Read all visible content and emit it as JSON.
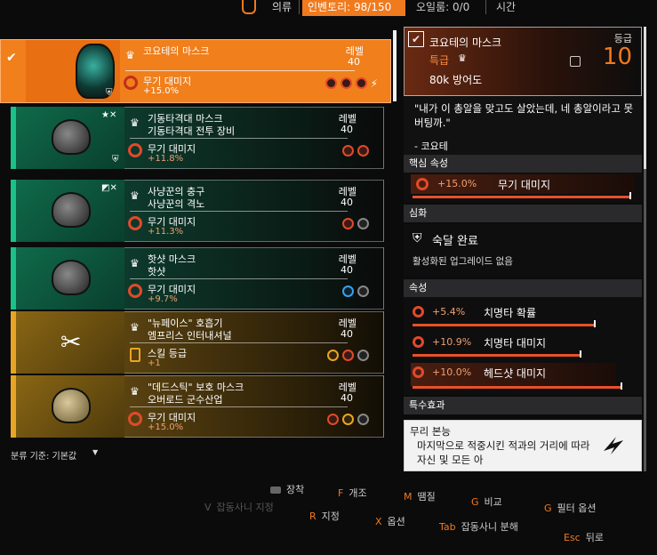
{
  "top": {
    "clothes_tab": "의류",
    "inventory_tab": "인벤토리: 98/150",
    "money_partial": "오일룸: 0/0",
    "time_partial": "시간"
  },
  "list": {
    "selected": {
      "name": "코요테의 마스크",
      "level_label": "레벨",
      "level": "40",
      "attr_name": "무기 대미지",
      "attr_value": "+15.0%"
    },
    "items": [
      {
        "tags": "★✕",
        "name1": "기동타격대 마스크",
        "name2": "기동타격대 전투 장비",
        "level_label": "레벨",
        "level": "40",
        "attr_name": "무기 대미지",
        "attr_value": "+11.8%",
        "rarity": "green"
      },
      {
        "tags": "◩✕",
        "name1": "사냥꾼의 충구",
        "name2": "사냥꾼의 격노",
        "level_label": "레벨",
        "level": "40",
        "attr_name": "무기 대미지",
        "attr_value": "+11.3%",
        "rarity": "green"
      },
      {
        "tags": "",
        "name1": "핫샷 마스크",
        "name2": "핫샷",
        "level_label": "레벨",
        "level": "40",
        "attr_name": "무기 대미지",
        "attr_value": "+9.7%",
        "rarity": "green"
      },
      {
        "tags": "",
        "name1": "\"뉴페이스\" 호흡기",
        "name2": "엠프리스 인터내셔널",
        "level_label": "레벨",
        "level": "40",
        "attr_name": "스킬 등급",
        "attr_value": "+1",
        "rarity": "gold"
      },
      {
        "tags": "",
        "name1": "\"데드스틱\" 보호 마스크",
        "name2": "오버로드 군수산업",
        "level_label": "레벨",
        "level": "40",
        "attr_name": "무기 대미지",
        "attr_value": "+15.0%",
        "rarity": "gold"
      }
    ],
    "sort_label": "분류 기준: 기본값"
  },
  "detail": {
    "name": "코요테의 마스크",
    "grade_label": "등급",
    "grade": "10",
    "rarity": "특급",
    "armor": "80k 방어도",
    "quote": "\"내가 이 총알을 맞고도 살았는데, 네 총알이라고 못 버팅까.\"",
    "author": "- 코요테",
    "core_header": "핵심 속성",
    "core_value": "+15.0%",
    "core_name": "무기 대미지",
    "mod_header": "심화",
    "talent_name": "숙달 완료",
    "talent_desc": "활성화된 업그레이드 없음",
    "attr_header": "속성",
    "attrs": [
      {
        "value": "+5.4%",
        "name": "치명타 확률"
      },
      {
        "value": "+10.9%",
        "name": "치명타 대미지"
      },
      {
        "value": "+10.0%",
        "name": "헤드샷 대미지"
      }
    ],
    "special_header": "특수효과",
    "special_title": "무리 본능",
    "special_desc": "마지막으로 적중시킨 적과의 거리에 따라 자신 및 모든 아"
  },
  "hotkeys": {
    "equip": "장착",
    "f_key": "F",
    "f_label": "개조",
    "m_key": "M",
    "m_label": "땜질",
    "g1_key": "G",
    "g1_label": "비교",
    "g2_key": "G",
    "g2_label": "필터 옵션",
    "v_key": "V",
    "v_label": "잡동사니 지정",
    "r_key": "R",
    "r_label": "지정",
    "x_key": "X",
    "x_label": "옵션",
    "tab_key": "Tab",
    "tab_label": "잡동사니 분해",
    "esc_key": "Esc",
    "esc_label": "뒤로"
  }
}
